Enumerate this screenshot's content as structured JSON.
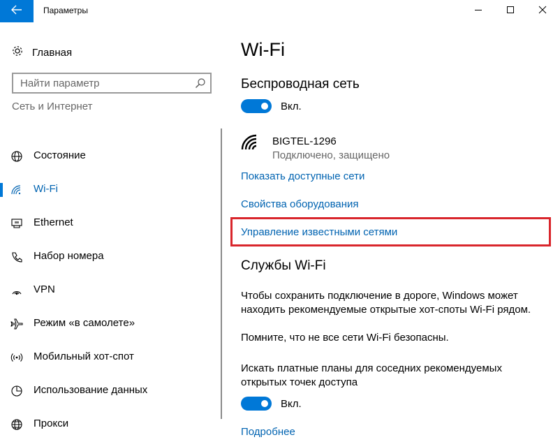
{
  "window": {
    "title": "Параметры",
    "back_icon": "arrow-left-icon",
    "accent": "#0078d7"
  },
  "sidebar": {
    "home_label": "Главная",
    "search_placeholder": "Найти параметр",
    "group_header": "Сеть и Интернет",
    "items": [
      {
        "label": "Состояние",
        "icon": "globe-icon"
      },
      {
        "label": "Wi-Fi",
        "icon": "wifi-icon",
        "active": true
      },
      {
        "label": "Ethernet",
        "icon": "ethernet-icon"
      },
      {
        "label": "Набор номера",
        "icon": "dialup-icon"
      },
      {
        "label": "VPN",
        "icon": "vpn-icon"
      },
      {
        "label": "Режим «в самолете»",
        "icon": "airplane-icon"
      },
      {
        "label": "Мобильный хот-спот",
        "icon": "hotspot-icon"
      },
      {
        "label": "Использование данных",
        "icon": "data-usage-icon"
      },
      {
        "label": "Прокси",
        "icon": "proxy-icon"
      }
    ]
  },
  "main": {
    "title": "Wi-Fi",
    "wireless_section": "Беспроводная сеть",
    "wireless_toggle": {
      "state": "on",
      "label": "Вкл."
    },
    "network": {
      "name": "BIGTEL-1296",
      "status": "Подключено, защищено"
    },
    "links": {
      "show_networks": "Показать доступные сети",
      "hardware_properties": "Свойства оборудования",
      "manage_known": "Управление известными сетями"
    },
    "services_section": "Службы Wi-Fi",
    "services_text_1": "Чтобы сохранить подключение в дороге, Windows может находить рекомендуемые открытые хот-споты Wi-Fi рядом.",
    "services_text_2": "Помните, что не все сети Wi-Fi безопасны.",
    "paid_plans_text": "Искать платные планы для соседних рекомендуемых открытых точек доступа",
    "paid_toggle": {
      "state": "on",
      "label": "Вкл."
    },
    "more_link": "Подробнее",
    "highlight_color": "#d9262c"
  }
}
